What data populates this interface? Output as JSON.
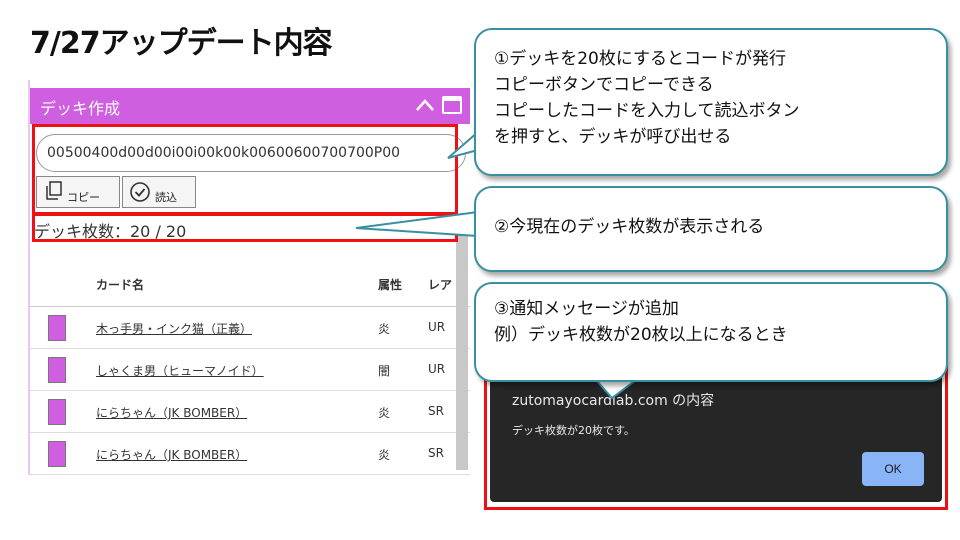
{
  "page": {
    "title": "7/27アップデート内容"
  },
  "panel": {
    "title": "デッキ作成",
    "code_value": "00500400d00d00i00i00k00k00600600700700P00",
    "copy_label": "コピー",
    "load_label": "読込",
    "deck_count": "デッキ枚数：20 / 20",
    "accent_color": "#cf5fe0"
  },
  "table": {
    "headers": {
      "name": "カード名",
      "attr": "属性",
      "rarity": "レア"
    },
    "rows": [
      {
        "name": "木っ手男・インク猫（正義）",
        "attr": "炎",
        "rarity": "UR"
      },
      {
        "name": "しゃくま男（ヒューマノイド）",
        "attr": "闇",
        "rarity": "UR"
      },
      {
        "name": "にらちゃん（JK BOMBER）",
        "attr": "炎",
        "rarity": "SR"
      },
      {
        "name": "にらちゃん（JK BOMBER）",
        "attr": "炎",
        "rarity": "SR"
      }
    ]
  },
  "dialog": {
    "title": "zutomayocardlab.com の内容",
    "message": "デッキ枚数が20枚です。",
    "ok_label": "OK"
  },
  "callouts": {
    "c1": [
      "①デッキを20枚にするとコードが発行",
      "コピーボタンでコピーできる",
      "コピーしたコードを入力して読込ボタン",
      "を押すと、デッキが呼び出せる"
    ],
    "c2": [
      "②今現在のデッキ枚数が表示される"
    ],
    "c3": [
      "③通知メッセージが追加",
      "例）デッキ枚数が20枚以上になるとき"
    ]
  },
  "icons": {
    "collapse": "chevron-up-icon",
    "window": "window-icon",
    "copy": "copy-icon",
    "load": "check-circle-icon"
  },
  "colors": {
    "highlight": "#ee1111",
    "callout_border": "#3a8fa0",
    "dialog_bg": "#262626",
    "ok_button": "#8ab4f8"
  }
}
